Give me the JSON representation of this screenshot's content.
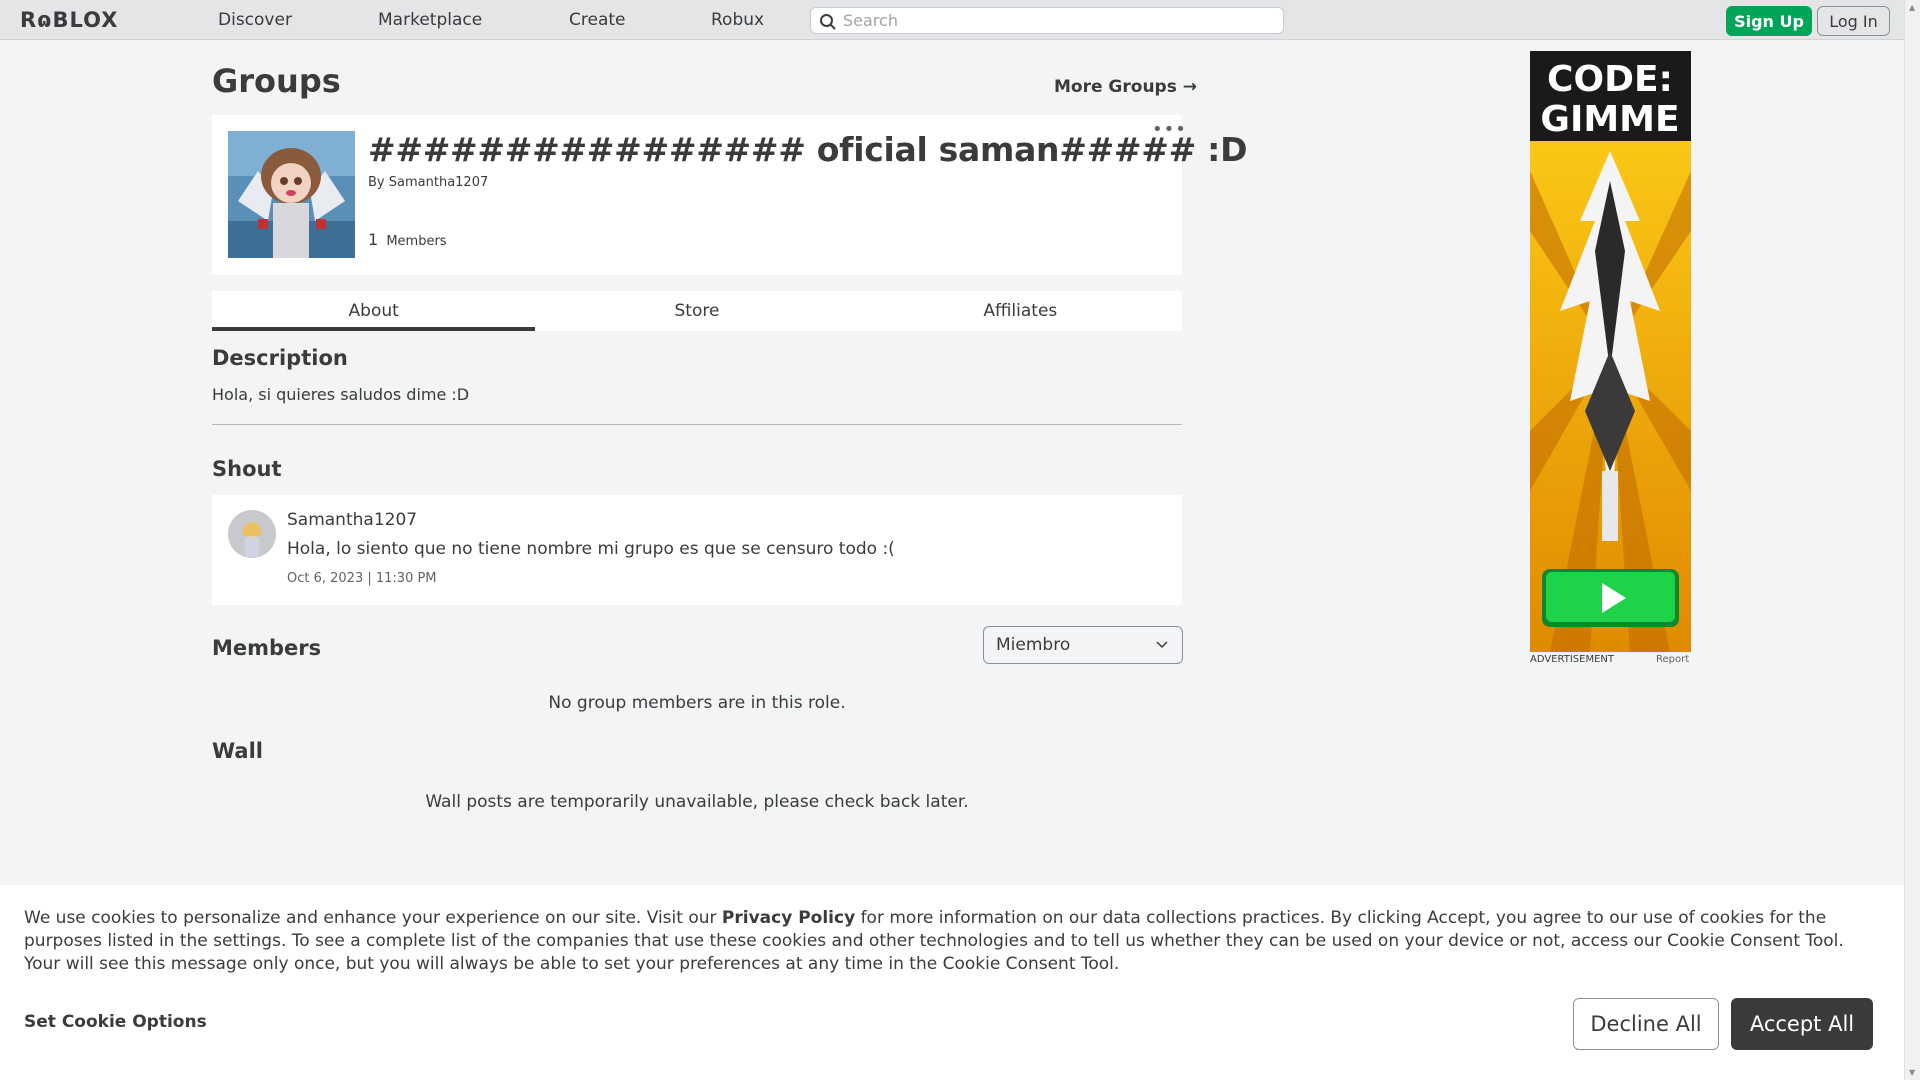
{
  "nav": {
    "logo": "RɷBLOX",
    "links": [
      "Discover",
      "Marketplace",
      "Create",
      "Robux"
    ],
    "search_placeholder": "Search",
    "signup": "Sign Up",
    "login": "Log In"
  },
  "page": {
    "title": "Groups",
    "more_groups": "More Groups →"
  },
  "group": {
    "name": "################ oficial saman##### :D",
    "by_label": "By",
    "owner": "Samantha1207",
    "member_count": "1",
    "members_label": "Members",
    "more_icon": "•••"
  },
  "tabs": [
    "About",
    "Store",
    "Affiliates"
  ],
  "description": {
    "title": "Description",
    "text": "Hola, si quieres saludos dime :D"
  },
  "shout": {
    "title": "Shout",
    "user": "Samantha1207",
    "message": "Hola, lo siento que no tiene nombre mi grupo es que se censuro todo :(",
    "date": "Oct 6, 2023 | 11:30 PM"
  },
  "members": {
    "title": "Members",
    "role_selected": "Miembro",
    "empty_note": "No group members are in this role."
  },
  "wall": {
    "title": "Wall",
    "note": "Wall posts are temporarily unavailable, please check back later."
  },
  "ad": {
    "headline": "CODE: GIMME",
    "label": "ADVERTISEMENT",
    "report": "Report"
  },
  "cookie": {
    "text_before": "We use cookies to personalize and enhance your experience on our site. Visit our ",
    "link": "Privacy Policy",
    "text_after": " for more information on our data collections practices. By clicking Accept, you agree to our use of cookies for the purposes listed in the settings. To see a complete list of the companies that use these cookies and other technologies and to tell us whether they can be used on your device or not, access our Cookie Consent Tool. Your will see this message only once, but you will always be able to set your preferences at any time in the Cookie Consent Tool.",
    "set_options": "Set Cookie Options",
    "decline": "Decline All",
    "accept": "Accept All"
  },
  "colors": {
    "accent_green": "#00a55a",
    "text": "#393b3d",
    "background": "#f2f4f5"
  }
}
